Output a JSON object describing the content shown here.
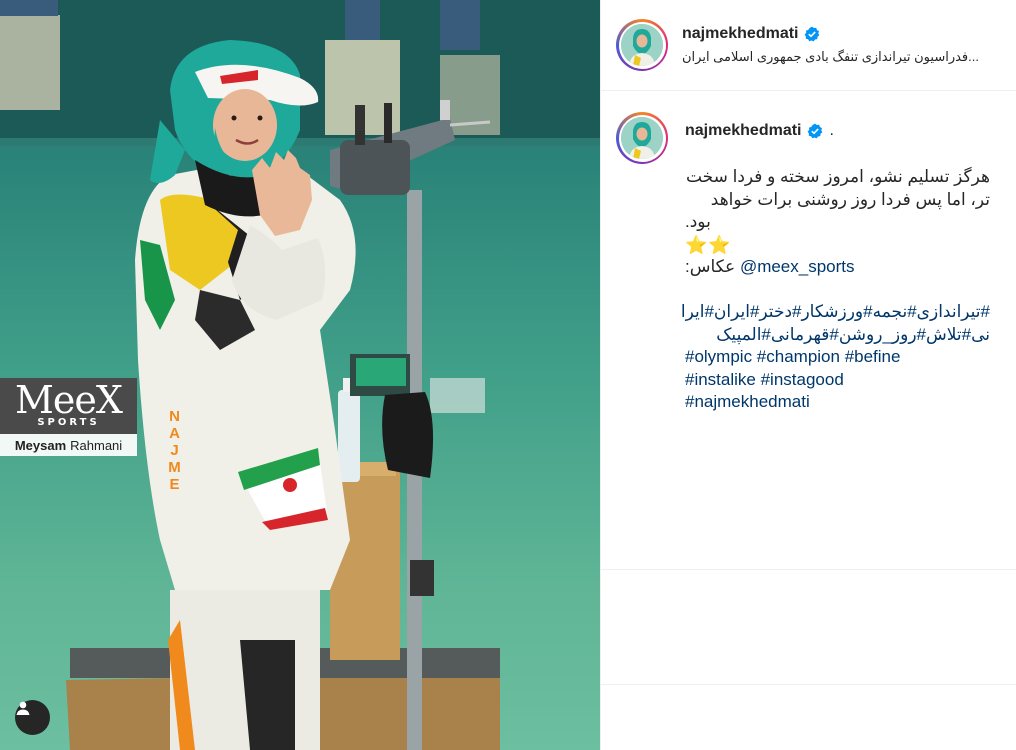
{
  "post": {
    "username": "najmekhedmati",
    "location": "...فدراسیون تیراندازی تنفگ بادی جمهوری اسلامی ایران",
    "caption_dot": ".",
    "caption_line1": "هرگز تسلیم نشو، امروز سخته و فردا سخت",
    "caption_line2": "تر، اما پس فردا روز روشنی برات خواهد",
    "caption_line3": ".بود",
    "stars": "⭐⭐",
    "photo_credit_label": ":عکاس",
    "photo_credit_handle": "@meex_sports",
    "hashtags_fa_1": "#تیراندازی#نجمه#ورزشکار#دختر#ایران#ایرا",
    "hashtags_fa_2": "نی#تلاش#روز_روشن#قهرمانی#المپیک",
    "hashtags_en_1": "#olympic #champion #befine",
    "hashtags_en_2": "#instalike #instagood",
    "hashtags_en_3": "#najmekhedmati"
  },
  "watermark": {
    "logo": "MeeX",
    "sub": "SPORTS",
    "credit_first": "Meysam",
    "credit_last": "Rahmani"
  },
  "photo_text": {
    "sleeve": "NAJME"
  },
  "icons": {
    "verified": "verified-badge-icon",
    "user_tag": "user-tag-icon"
  },
  "colors": {
    "verified_blue": "#0095f6",
    "link": "#00376b",
    "hijab_teal": "#1fa99a"
  }
}
